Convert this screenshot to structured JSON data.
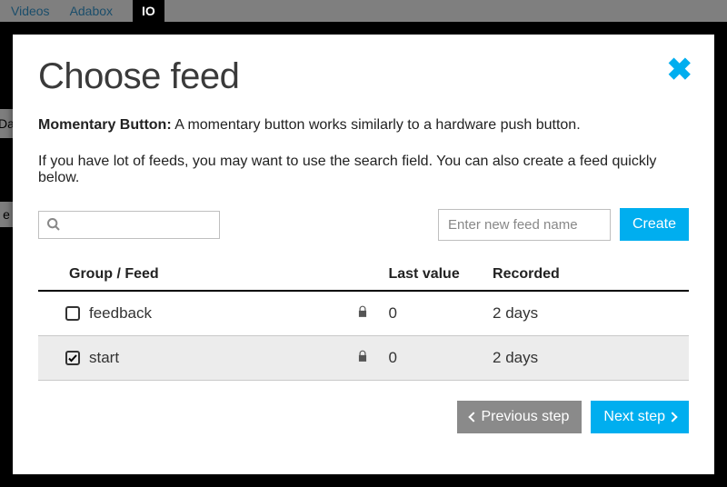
{
  "topbar": {
    "nav": [
      "Videos",
      "Adabox"
    ],
    "active_tab": "IO"
  },
  "behind": {
    "text1": "Da",
    "text2": "e"
  },
  "modal": {
    "title": "Choose feed",
    "desc_bold": "Momentary Button:",
    "desc_text": " A momentary button works similarly to a hardware push button.",
    "hint": "If you have lot of feeds, you may want to use the search field. You can also create a feed quickly below.",
    "search_placeholder": "",
    "new_feed_placeholder": "Enter new feed name",
    "create_label": "Create"
  },
  "table": {
    "headers": {
      "group": "Group / Feed",
      "last": "Last value",
      "recorded": "Recorded"
    },
    "rows": [
      {
        "checked": false,
        "name": "feedback",
        "locked": true,
        "last_value": "0",
        "recorded": "2 days"
      },
      {
        "checked": true,
        "name": "start",
        "locked": true,
        "last_value": "0",
        "recorded": "2 days"
      }
    ]
  },
  "footer": {
    "prev": "Previous step",
    "next": "Next step"
  }
}
